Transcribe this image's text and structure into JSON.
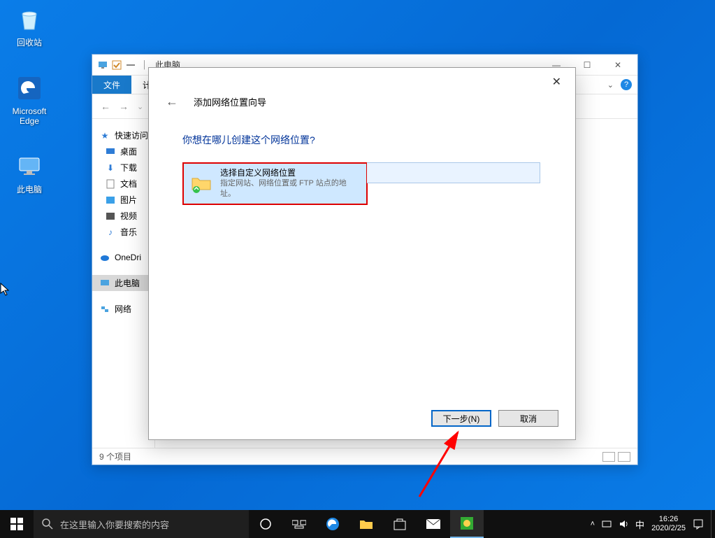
{
  "desktop": {
    "recycle": "回收站",
    "edge": "Microsoft Edge",
    "thispc": "此电脑"
  },
  "explorer": {
    "title": "此电脑",
    "tab_file": "文件",
    "tab_computer": "计",
    "nav_back": "←",
    "nav_fwd": "→",
    "nav_up": "↑",
    "sidebar": {
      "quick": "快速访问",
      "desktop": "桌面",
      "downloads": "下载",
      "documents": "文档",
      "pictures": "图片",
      "videos": "视频",
      "music": "音乐",
      "onedrive": "OneDri",
      "thispc": "此电脑",
      "network": "网络"
    },
    "status": "9 个项目"
  },
  "wizard": {
    "title": "添加网络位置向导",
    "question": "你想在哪儿创建这个网络位置?",
    "option_title": "选择自定义网络位置",
    "option_sub": "指定网站、网络位置或 FTP 站点的地址。",
    "next": "下一步(N)",
    "cancel": "取消"
  },
  "taskbar": {
    "search_placeholder": "在这里输入你要搜索的内容",
    "ime": "中",
    "time": "16:26",
    "date": "2020/2/25"
  }
}
